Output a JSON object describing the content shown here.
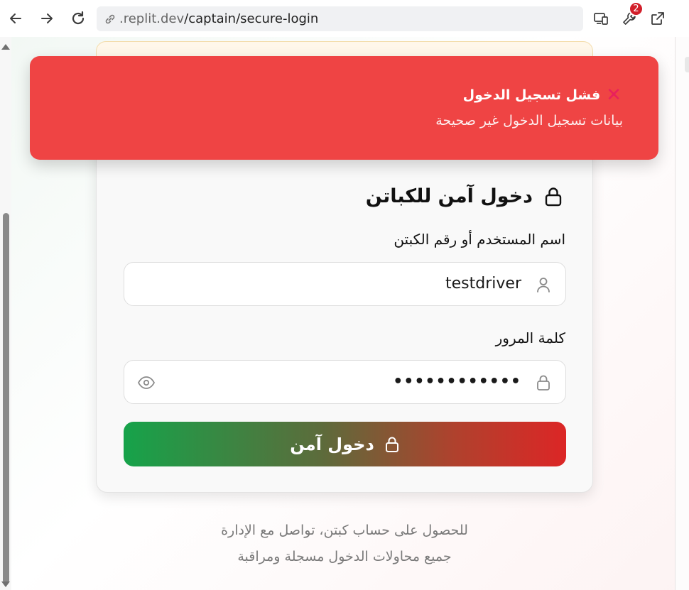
{
  "browser": {
    "url_host": ".replit.dev",
    "url_path": "/captain/secure-login",
    "extension_badge_count": "2"
  },
  "toast": {
    "title": "فشل تسجيل الدخول",
    "description": "بيانات تسجيل الدخول غير صحيحة",
    "accent_color": "#ef4444"
  },
  "login": {
    "title": "دخول آمن للكباتن",
    "username_label": "اسم المستخدم أو رقم الكبتن",
    "username_value": "testdriver",
    "password_label": "كلمة المرور",
    "password_value": "••••••••••••",
    "submit_label": "دخول آمن"
  },
  "footer": {
    "line1": "للحصول على حساب كبتن، تواصل مع الإدارة",
    "line2": "جميع محاولات الدخول مسجلة ومراقبة"
  },
  "icons": {
    "back": "arrow-left-icon",
    "forward": "arrow-right-icon",
    "reload": "reload-icon",
    "lock": "lock-icon",
    "user": "user-icon",
    "eye": "eye-icon"
  }
}
